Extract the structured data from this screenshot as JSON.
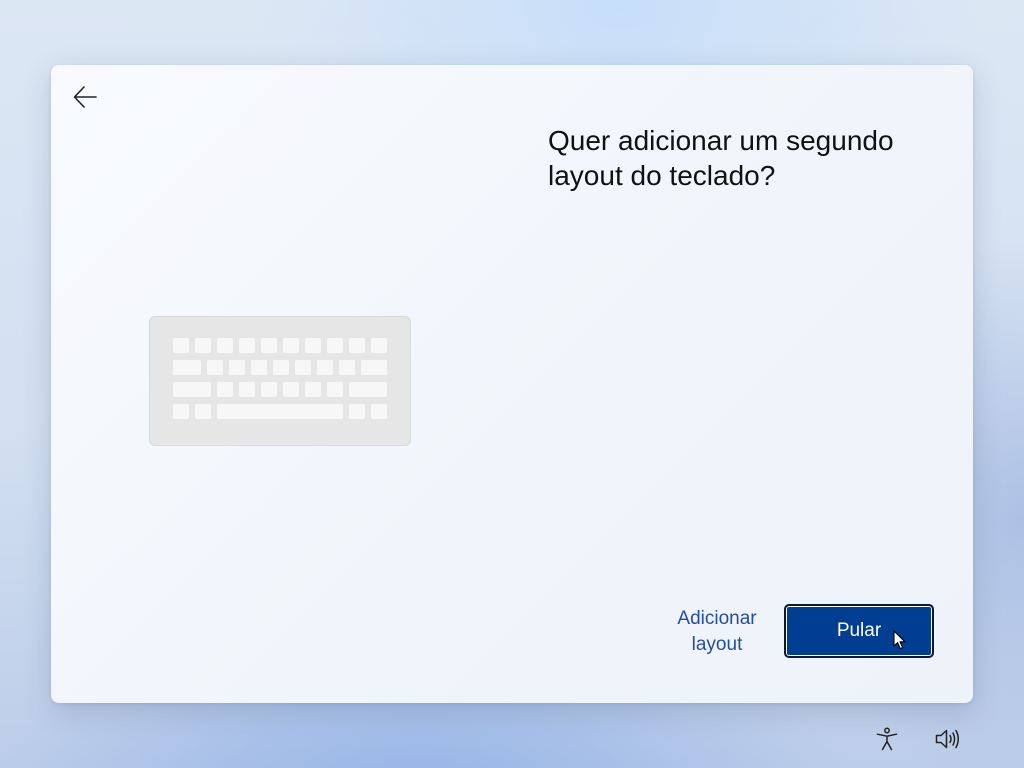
{
  "dialog": {
    "title": "Quer adicionar um segundo layout do teclado?",
    "back_icon": "back-arrow-icon",
    "illustration_icon": "keyboard-icon"
  },
  "actions": {
    "add_layout_label": "Adicionar layout",
    "skip_label": "Pular"
  },
  "taskbar": {
    "icons": [
      "accessibility-icon",
      "volume-icon"
    ]
  },
  "colors": {
    "primary_button": "#003e92",
    "link": "#1f4f9e"
  }
}
